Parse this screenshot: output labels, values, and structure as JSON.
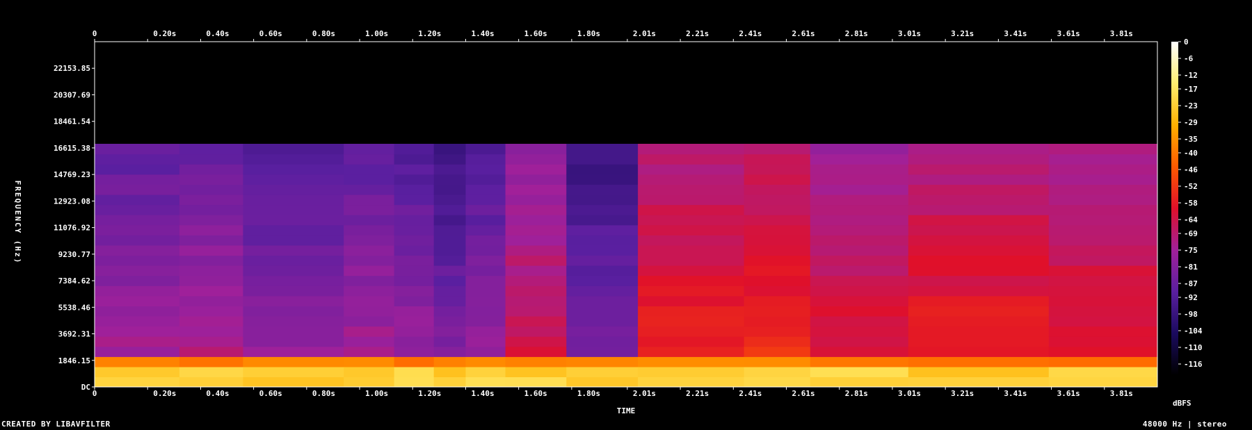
{
  "chart_data": {
    "type": "heatmap",
    "title": "",
    "xlabel": "TIME",
    "ylabel": "FREQUENCY (Hz)",
    "x_ticks": [
      "0",
      "0.20s",
      "0.40s",
      "0.60s",
      "0.80s",
      "1.00s",
      "1.20s",
      "1.40s",
      "1.60s",
      "1.80s",
      "2.01s",
      "2.21s",
      "2.41s",
      "2.61s",
      "2.81s",
      "3.01s",
      "3.21s",
      "3.41s",
      "3.61s",
      "3.81s"
    ],
    "x_tick_values": [
      0,
      0.2,
      0.4,
      0.6,
      0.8,
      1.0,
      1.2,
      1.4,
      1.6,
      1.8,
      2.01,
      2.21,
      2.41,
      2.61,
      2.81,
      3.01,
      3.21,
      3.41,
      3.61,
      3.81
    ],
    "xlim": [
      0,
      4.01
    ],
    "y_ticks": [
      "DC",
      "1846.15",
      "3692.31",
      "5538.46",
      "7384.62",
      "9230.77",
      "11076.92",
      "12923.08",
      "14769.23",
      "16615.38",
      "18461.54",
      "20307.69",
      "22153.85"
    ],
    "y_tick_values": [
      0,
      1846.15,
      3692.31,
      5538.46,
      7384.62,
      9230.77,
      11076.92,
      12923.08,
      14769.23,
      16615.38,
      18461.54,
      20307.69,
      22153.85
    ],
    "ylim": [
      0,
      24000
    ],
    "colorbar": {
      "label": "dBFS",
      "ticks": [
        "0",
        "-6",
        "-12",
        "-17",
        "-23",
        "-29",
        "-35",
        "-40",
        "-46",
        "-52",
        "-58",
        "-64",
        "-69",
        "-75",
        "-81",
        "-87",
        "-92",
        "-98",
        "-104",
        "-110",
        "-116"
      ],
      "range": [
        -120,
        0
      ],
      "colors": [
        "#000000",
        "#1a0a5e",
        "#5a1fa0",
        "#a0209a",
        "#e0102a",
        "#ff5a00",
        "#ffb000",
        "#ffef70",
        "#ffffff"
      ]
    },
    "cutoff_frequency_hz": 16900,
    "segments": [
      {
        "t0": 0.0,
        "t1": 0.32,
        "level": -80
      },
      {
        "t0": 0.32,
        "t1": 0.56,
        "level": -78
      },
      {
        "t0": 0.56,
        "t1": 0.94,
        "level": -84
      },
      {
        "t0": 0.94,
        "t1": 1.13,
        "level": -80
      },
      {
        "t0": 1.13,
        "t1": 1.28,
        "level": -82
      },
      {
        "t0": 1.28,
        "t1": 1.4,
        "level": -88
      },
      {
        "t0": 1.4,
        "t1": 1.55,
        "level": -84
      },
      {
        "t0": 1.55,
        "t1": 1.78,
        "level": -70
      },
      {
        "t0": 1.78,
        "t1": 2.05,
        "level": -88
      },
      {
        "t0": 2.05,
        "t1": 2.45,
        "level": -62
      },
      {
        "t0": 2.45,
        "t1": 2.7,
        "level": -60
      },
      {
        "t0": 2.7,
        "t1": 3.07,
        "level": -66
      },
      {
        "t0": 3.07,
        "t1": 3.6,
        "level": -62
      },
      {
        "t0": 3.6,
        "t1": 4.01,
        "level": -64
      }
    ]
  },
  "footer": {
    "created_by": "CREATED BY LIBAVFILTER",
    "sample_info": "48000 Hz | stereo"
  }
}
